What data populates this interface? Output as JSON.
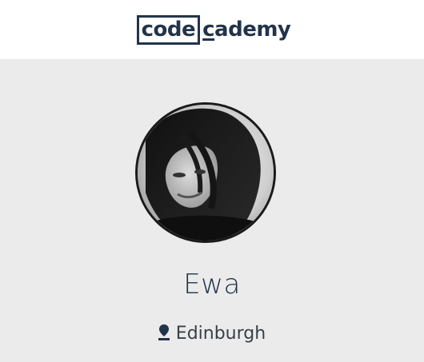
{
  "header": {
    "logo_box_text": "code",
    "logo_rest_underlined": "c",
    "logo_rest_text": "ademy"
  },
  "profile": {
    "avatar_icon": "user-photo",
    "name": "Ewa",
    "location": "Edinburgh",
    "location_icon": "map-pin-icon"
  },
  "colors": {
    "brand_text": "#22344a",
    "header_bg": "#ffffff",
    "profile_bg": "#ebebeb",
    "avatar_border": "#1a1a1a"
  }
}
